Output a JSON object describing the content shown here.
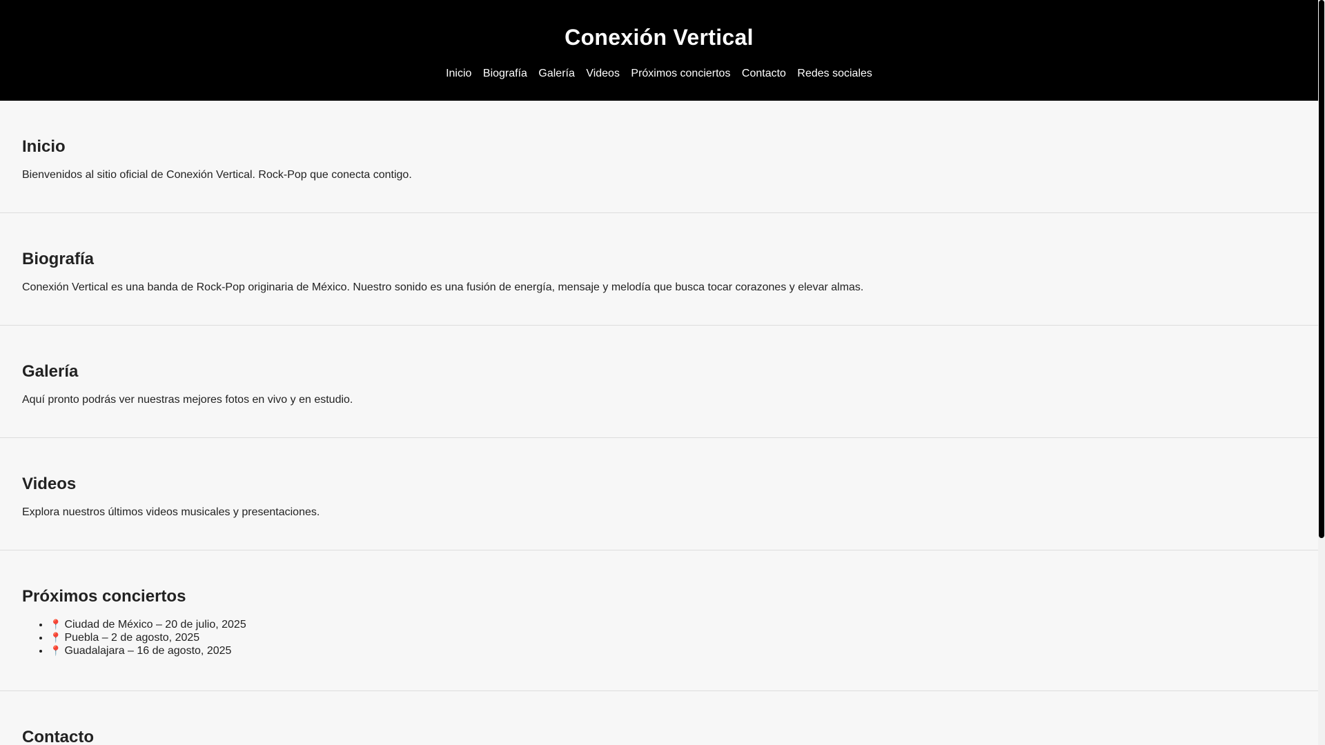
{
  "header": {
    "title": "Conexión Vertical",
    "nav": [
      "Inicio",
      "Biografía",
      "Galería",
      "Videos",
      "Próximos conciertos",
      "Contacto",
      "Redes sociales"
    ]
  },
  "sections": {
    "inicio": {
      "heading": "Inicio",
      "text": "Bienvenidos al sitio oficial de Conexión Vertical. Rock-Pop que conecta contigo."
    },
    "biografia": {
      "heading": "Biografía",
      "text": "Conexión Vertical es una banda de Rock-Pop originaria de México. Nuestro sonido es una fusión de energía, mensaje y melodía que busca tocar corazones y elevar almas."
    },
    "galeria": {
      "heading": "Galería",
      "text": "Aquí pronto podrás ver nuestras mejores fotos en vivo y en estudio."
    },
    "videos": {
      "heading": "Videos",
      "text": "Explora nuestros últimos videos musicales y presentaciones."
    },
    "conciertos": {
      "heading": "Próximos conciertos",
      "items": [
        "Ciudad de México – 20 de julio, 2025",
        "Puebla – 2 de agosto, 2025",
        "Guadalajara – 16 de agosto, 2025"
      ]
    },
    "contacto": {
      "heading": "Contacto"
    }
  },
  "icons": {
    "concert_item": "round-pushpin-icon"
  },
  "colors": {
    "header_bg": "#000000",
    "page_bg": "#f7f7f7",
    "pin": "#d62828"
  }
}
